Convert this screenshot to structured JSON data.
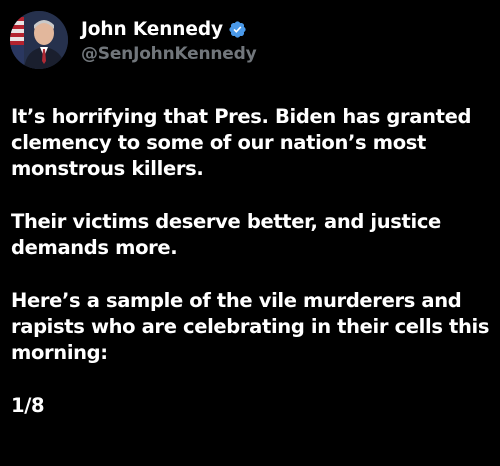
{
  "post": {
    "author": {
      "display_name": "John Kennedy",
      "handle": "@SenJohnKennedy",
      "verified_icon": "verified-badge-icon"
    },
    "paragraphs": [
      "It’s horrifying that Pres. Biden has granted clemency to some of our nation’s most monstrous killers.",
      "Their victims deserve better, and justice demands more.",
      "Here’s a sample of the vile murderers and rapists who are celebrating in their cells this morning:",
      "1/8"
    ]
  },
  "colors": {
    "background": "#000000",
    "text": "#ffffff",
    "handle": "#71767b",
    "verified": "#4a99e9"
  }
}
